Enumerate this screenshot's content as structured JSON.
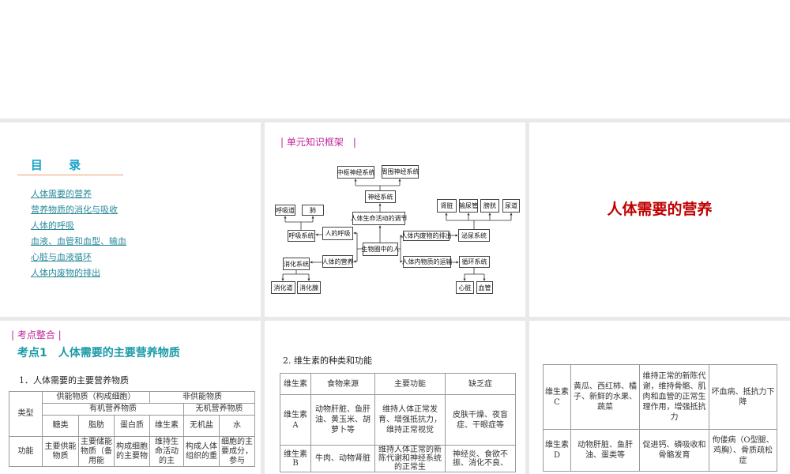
{
  "slide1": {
    "toc_title": "目 录",
    "items": [
      "人体需要的营养",
      "营养物质的消化与吸收",
      "人体的呼吸",
      "血液、血管和血型、输血",
      "心脏与血液循环",
      "人体内废物的排出"
    ]
  },
  "slide2": {
    "section": "| 单元知识框架　|",
    "nodes": {
      "cns": "中枢神经系统",
      "pns": "周围神经系统",
      "ns": "神经系统",
      "reg": "人体生命活动的调节",
      "airway": "呼吸道",
      "lung": "肺",
      "resp_sys": "呼吸系统",
      "breath": "人的呼吸",
      "center": "生物圈中的人",
      "nutri": "人体的营养",
      "dig_sys": "消化系统",
      "dig_tract": "消化道",
      "dig_gland": "消化腺",
      "excr": "人体内废物的排出",
      "urin_sys": "泌尿系统",
      "kidney": "肾脏",
      "ureter": "输尿管",
      "bladder": "膀胱",
      "urethra": "尿道",
      "transport": "人体内物质的运输",
      "circ_sys": "循环系统",
      "heart": "心脏",
      "vessel": "血管"
    }
  },
  "slide3": {
    "title": "人体需要的营养"
  },
  "slide4": {
    "section": "| 考点整合 |",
    "title": "考点1　人体需要的主要营养物质",
    "subtitle": "1．人体需要的主要营养物质",
    "table": {
      "type_label": "类型",
      "energy": "供能物质（构成细胞）",
      "nonenergy": "非供能物质",
      "organic": "有机营养物质",
      "inorganic": "无机营养物质",
      "cols": [
        "糖类",
        "脂肪",
        "蛋白质",
        "维生素",
        "无机盐",
        "水"
      ],
      "func_label": "功能",
      "funcs": [
        "主要供能物质",
        "主要储能物质（备用能",
        "构成细胞的主要物",
        "维持生命活动的主",
        "构成人体组织的重",
        "细胞的主要成分，参与"
      ]
    }
  },
  "slide5": {
    "subtitle": "2. 维生素的种类和功能",
    "headers": [
      "维生素",
      "食物来源",
      "主要功能",
      "缺乏症"
    ],
    "rows": [
      [
        "维生素A",
        "动物肝脏、鱼肝油、黄玉米、胡萝卜等",
        "维持人体正常发育、增强抵抗力，维持正常视觉",
        "皮肤干燥、夜盲症、干眼症等"
      ],
      [
        "维生素B",
        "牛肉、动物肾脏",
        "维持人体正常的新陈代谢和神经系统的正常生",
        "神经炎、食欲不振、消化不良、"
      ]
    ]
  },
  "slide6": {
    "rows": [
      [
        "维生素C",
        "黄瓜、西红柿、橘子、新鲜的水果、蔬菜",
        "维持正常的新陈代谢，维持骨骼、肌肉和血管的正常生理作用，增强抵抗力",
        "坏血病、抵抗力下降"
      ],
      [
        "维生素D",
        "动物肝脏、鱼肝油、蛋类等",
        "促进钙、磷吸收和骨骼发育",
        "佝偻病（O型腿、鸡胸）、骨质疏松症"
      ]
    ]
  },
  "colors": {
    "toc": "#17a2c8",
    "section": "#c0259a",
    "red_title": "#c00000"
  }
}
